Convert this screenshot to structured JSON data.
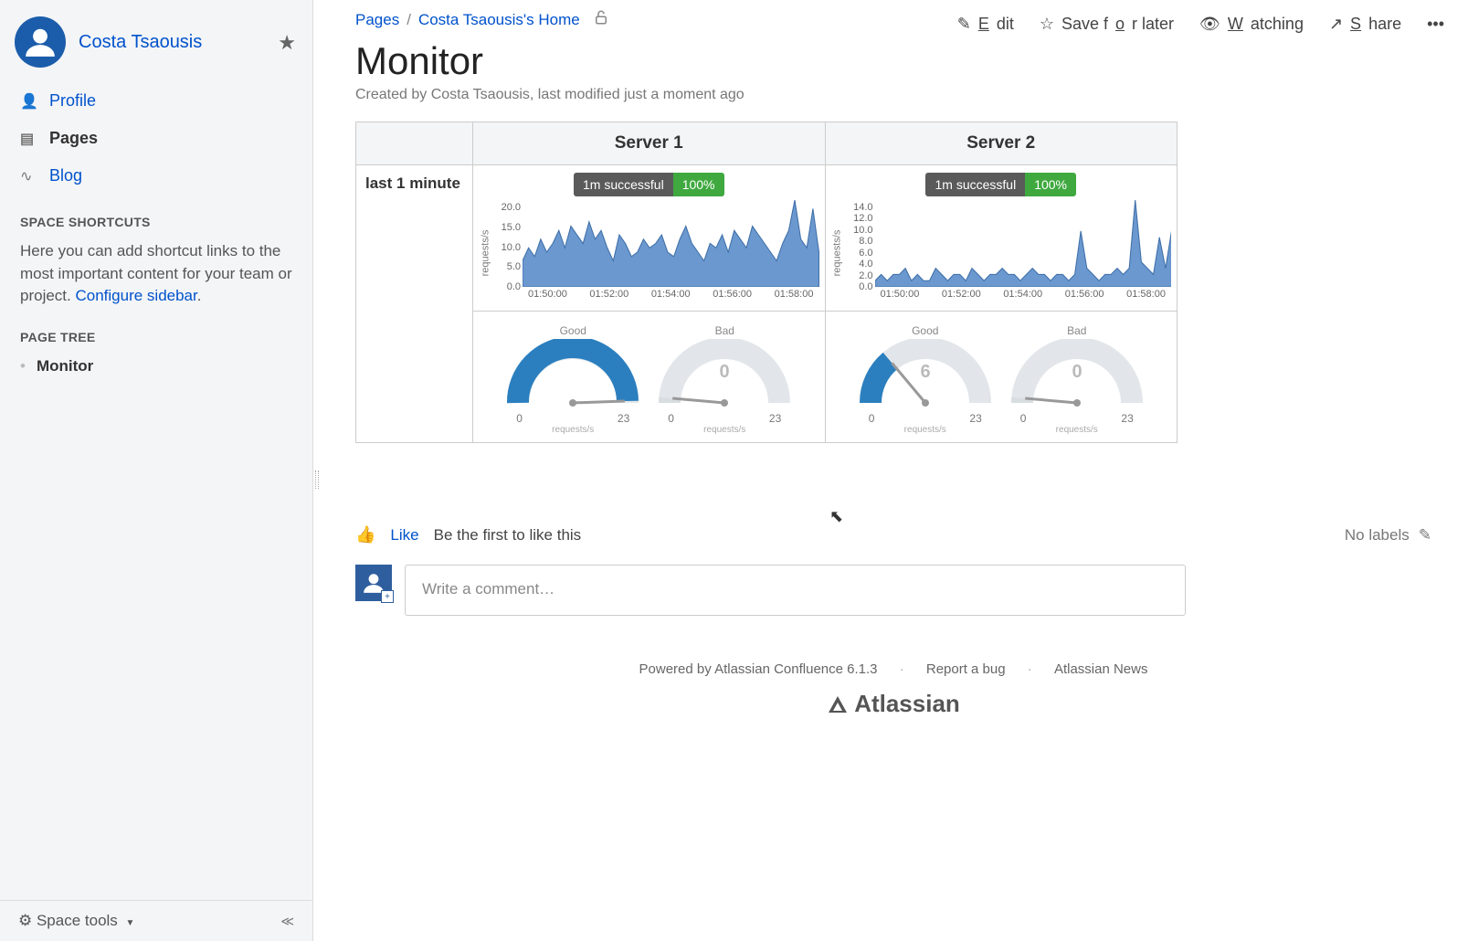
{
  "sidebar": {
    "user": "Costa Tsaousis",
    "nav": [
      {
        "icon": "person-icon",
        "label": "Profile",
        "active": false,
        "link": true
      },
      {
        "icon": "pages-icon",
        "label": "Pages",
        "active": true,
        "link": false
      },
      {
        "icon": "rss-icon",
        "label": "Blog",
        "active": false,
        "link": true
      }
    ],
    "shortcuts_title": "SPACE SHORTCUTS",
    "shortcuts_text": "Here you can add shortcut links to the most important content for your team or project. ",
    "shortcuts_link": "Configure sidebar",
    "tree_title": "PAGE TREE",
    "tree_items": [
      "Monitor"
    ],
    "tools_label": "Space tools"
  },
  "breadcrumb": {
    "root": "Pages",
    "page": "Costa Tsaousis's Home"
  },
  "actions": {
    "edit": "Edit",
    "save": "Save for later",
    "watch": "Watching",
    "share": "Share"
  },
  "page": {
    "title": "Monitor",
    "byline": "Created by Costa Tsaousis, last modified just a moment ago",
    "row_label": "last 1 minute",
    "servers": [
      "Server 1",
      "Server 2"
    ]
  },
  "chart_data": [
    {
      "type": "area",
      "title_badge": {
        "left": "1m successful",
        "right": "100%"
      },
      "ylabel": "requests/s",
      "yticks": [
        "20.0",
        "15.0",
        "10.0",
        "5.0",
        "0.0"
      ],
      "ylim": [
        0,
        20
      ],
      "xticks": [
        "01:50:00",
        "01:52:00",
        "01:54:00",
        "01:56:00",
        "01:58:00"
      ],
      "values": [
        6,
        9,
        7,
        11,
        8,
        10,
        13,
        9,
        14,
        12,
        10,
        15,
        11,
        13,
        9,
        6,
        12,
        10,
        7,
        8,
        11,
        9,
        10,
        12,
        8,
        7,
        11,
        14,
        10,
        8,
        6,
        10,
        9,
        12,
        8,
        13,
        11,
        9,
        14,
        12,
        10,
        8,
        6,
        10,
        13,
        20,
        11,
        9,
        18,
        8
      ],
      "gauges": [
        {
          "title": "Good",
          "value": 22,
          "min": "0",
          "max": "23",
          "unit": "requests/s",
          "fill": "#2b7fbf",
          "angle": 178
        },
        {
          "title": "Bad",
          "value": 0,
          "min": "0",
          "max": "23",
          "unit": "requests/s",
          "fill": "#d8dde0",
          "angle": 5
        }
      ]
    },
    {
      "type": "area",
      "title_badge": {
        "left": "1m successful",
        "right": "100%"
      },
      "ylabel": "requests/s",
      "yticks": [
        "14.0",
        "12.0",
        "10.0",
        "8.0",
        "6.0",
        "4.0",
        "2.0",
        "0.0"
      ],
      "ylim": [
        0,
        14
      ],
      "xticks": [
        "01:50:00",
        "01:52:00",
        "01:54:00",
        "01:56:00",
        "01:58:00"
      ],
      "values": [
        1,
        2,
        1,
        2,
        2,
        3,
        1,
        2,
        1,
        1,
        3,
        2,
        1,
        2,
        2,
        1,
        3,
        2,
        1,
        2,
        2,
        3,
        2,
        2,
        1,
        2,
        3,
        2,
        2,
        1,
        2,
        2,
        1,
        2,
        9,
        3,
        2,
        1,
        2,
        2,
        3,
        2,
        3,
        14,
        4,
        3,
        2,
        8,
        3,
        9
      ],
      "gauges": [
        {
          "title": "Good",
          "value": 6,
          "min": "0",
          "max": "23",
          "unit": "requests/s",
          "fill": "#2b7fbf",
          "angle": 50
        },
        {
          "title": "Bad",
          "value": 0,
          "min": "0",
          "max": "23",
          "unit": "requests/s",
          "fill": "#d8dde0",
          "angle": 5
        }
      ]
    }
  ],
  "page_foot": {
    "like": "Like",
    "be_first": "Be the first to like this",
    "no_labels": "No labels"
  },
  "comment": {
    "placeholder": "Write a comment…"
  },
  "footer": {
    "powered": "Powered by Atlassian Confluence 6.1.3",
    "bug": "Report a bug",
    "news": "Atlassian News",
    "brand": "Atlassian"
  }
}
